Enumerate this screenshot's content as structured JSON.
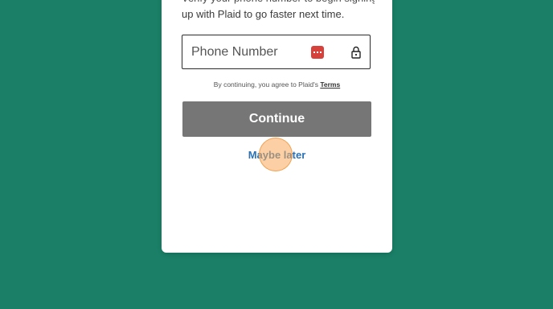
{
  "modal": {
    "intro_line1": "Verify your phone number to begin signing",
    "intro_line2": "up with Plaid to go faster next time.",
    "phone_placeholder": "Phone Number",
    "consent_text": "By continuing, you agree to Plaid's ",
    "terms_link": "Terms",
    "continue_label": "Continue",
    "maybe_later_label": "Maybe later"
  },
  "colors": {
    "background": "#1a7f66",
    "continue_button": "#767676",
    "link": "#2a72b5",
    "password_manager_icon": "#d6413b"
  },
  "icons": {
    "password_manager": "password-manager-icon",
    "lock": "lock-icon"
  }
}
